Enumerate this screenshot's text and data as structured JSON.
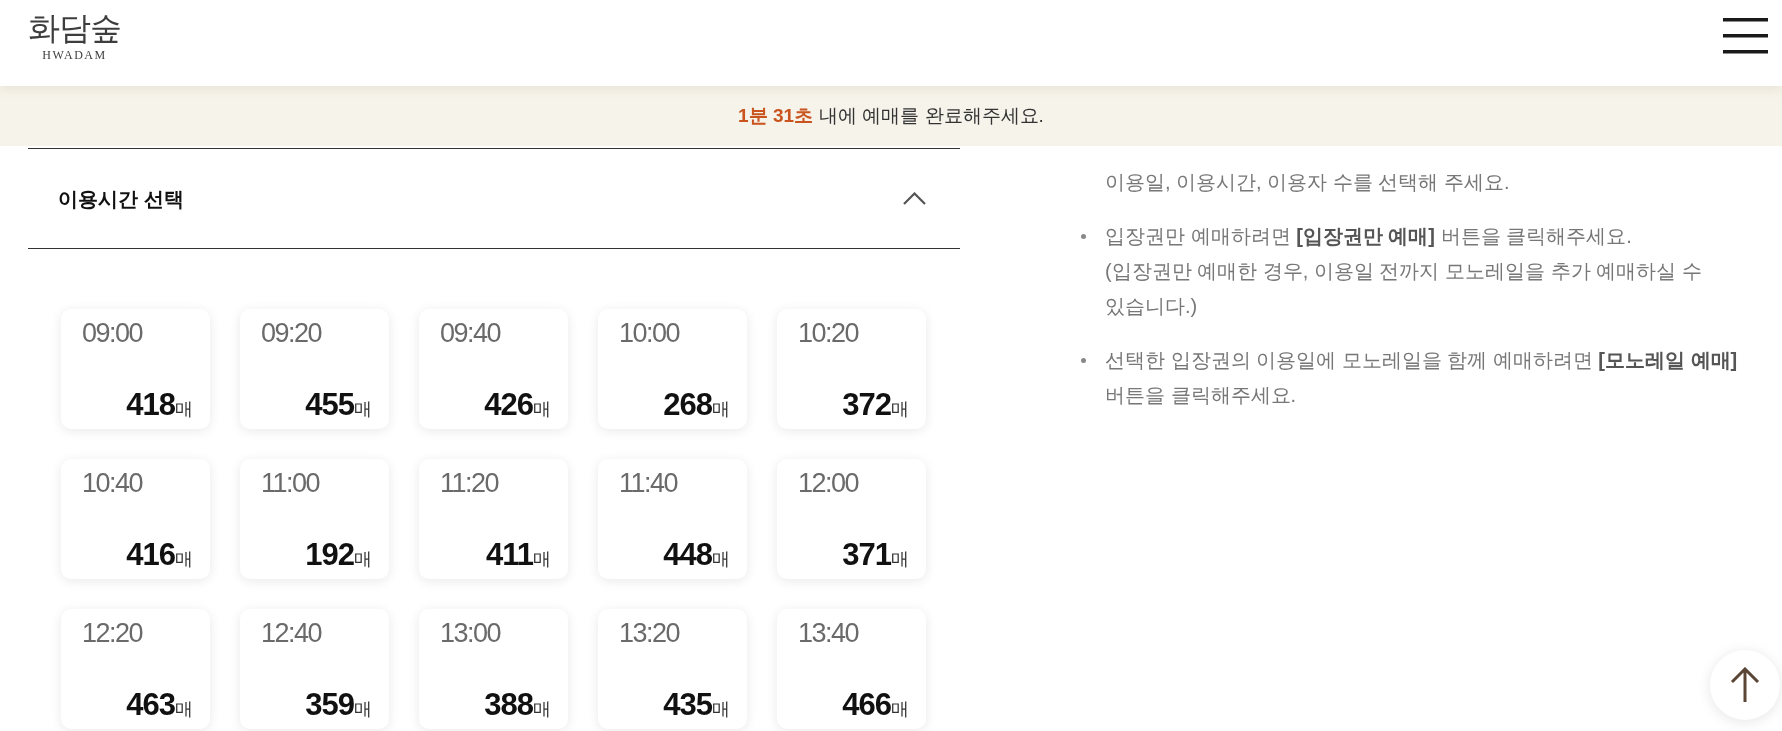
{
  "header": {
    "logo": {
      "wordmark": "화담숲",
      "subtitle": "HWADAM"
    }
  },
  "notice_banner": {
    "timer": "1분 31초",
    "message": "내에 예매를 완료해주세요."
  },
  "time_selection": {
    "title": "이용시간 선택",
    "expanded": true,
    "slots": [
      {
        "time": "09:00",
        "count": "418",
        "unit": "매"
      },
      {
        "time": "09:20",
        "count": "455",
        "unit": "매"
      },
      {
        "time": "09:40",
        "count": "426",
        "unit": "매"
      },
      {
        "time": "10:00",
        "count": "268",
        "unit": "매"
      },
      {
        "time": "10:20",
        "count": "372",
        "unit": "매"
      },
      {
        "time": "10:40",
        "count": "416",
        "unit": "매"
      },
      {
        "time": "11:00",
        "count": "192",
        "unit": "매"
      },
      {
        "time": "11:20",
        "count": "411",
        "unit": "매"
      },
      {
        "time": "11:40",
        "count": "448",
        "unit": "매"
      },
      {
        "time": "12:00",
        "count": "371",
        "unit": "매"
      },
      {
        "time": "12:20",
        "count": "463",
        "unit": "매"
      },
      {
        "time": "12:40",
        "count": "359",
        "unit": "매"
      },
      {
        "time": "13:00",
        "count": "388",
        "unit": "매"
      },
      {
        "time": "13:20",
        "count": "435",
        "unit": "매"
      },
      {
        "time": "13:40",
        "count": "466",
        "unit": "매"
      }
    ]
  },
  "guide": {
    "items": [
      {
        "kind": "continuation",
        "text": "이용일, 이용시간, 이용자 수를 선택해 주세요."
      },
      {
        "kind": "bullet",
        "text": "입장권만 예매하려면 **[입장권만 예매]** 버튼을 클릭해주세요.",
        "note": "(입장권만 예매한 경우, 이용일 전까지 모노레일을 추가 예매하실 수 있습니다.)"
      },
      {
        "kind": "bullet",
        "text": "선택한 입장권의 이용일에 모노레일을 함께 예매하려면 **[모노레일 예매]** 버튼을 클릭해주세요."
      }
    ]
  }
}
